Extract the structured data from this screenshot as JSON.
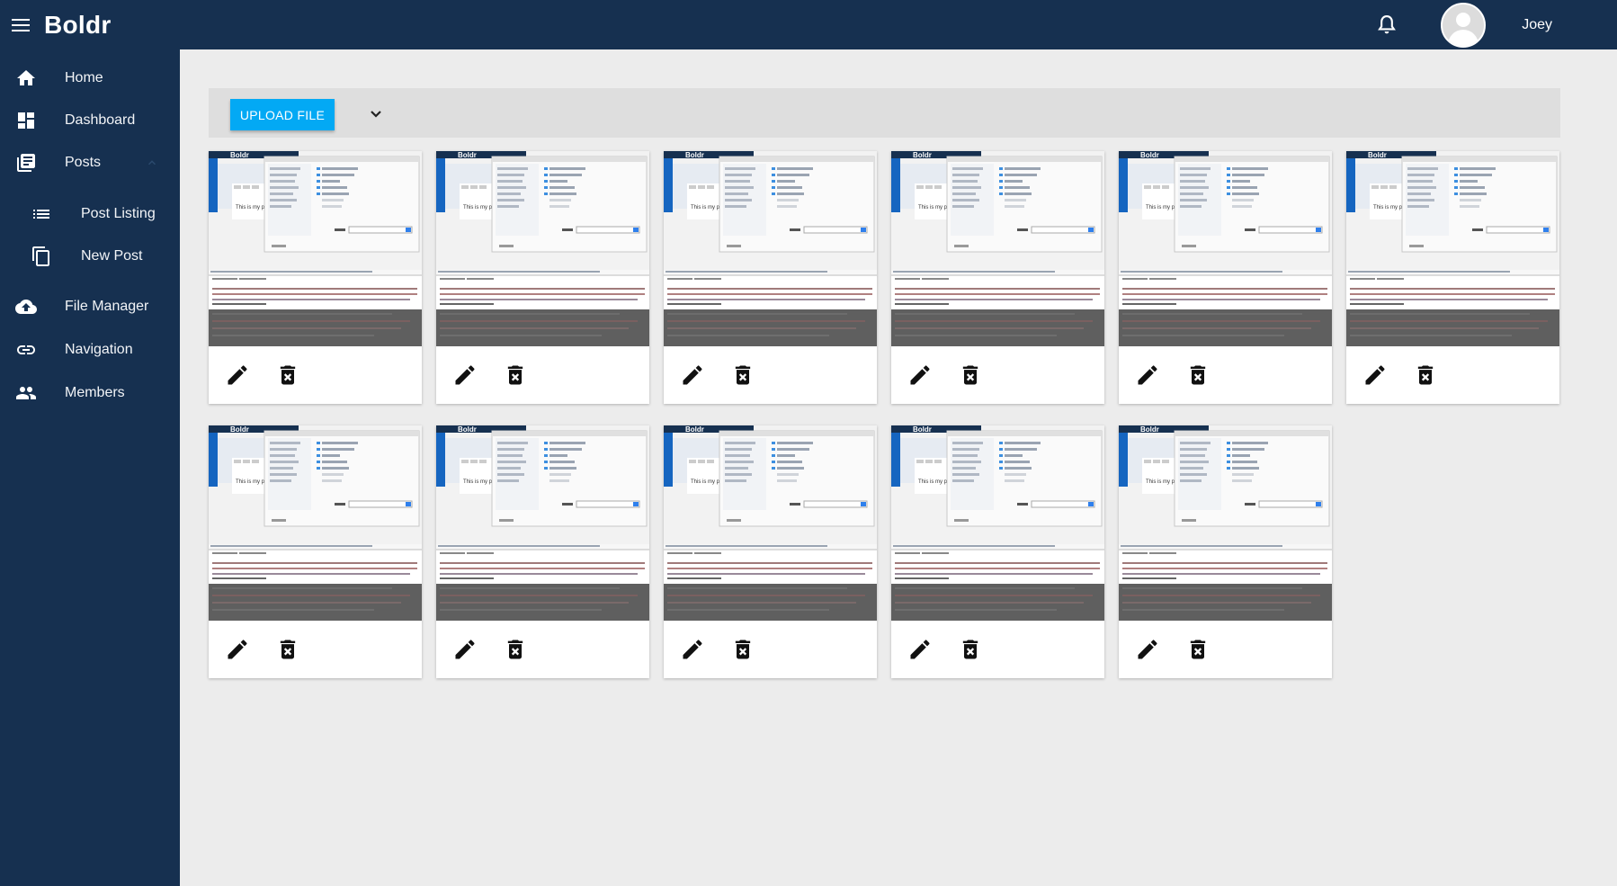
{
  "app": {
    "title": "Boldr"
  },
  "header": {
    "user_name": "Joey",
    "notifications_icon": "bell-icon"
  },
  "sidebar": {
    "items": [
      {
        "label": "Home",
        "icon": "home-icon"
      },
      {
        "label": "Dashboard",
        "icon": "dashboard-icon"
      },
      {
        "label": "Posts",
        "icon": "posts-icon"
      },
      {
        "label": "Post Listing",
        "icon": "list-icon"
      },
      {
        "label": "New Post",
        "icon": "copy-icon"
      },
      {
        "label": "File Manager",
        "icon": "cloud-upload-icon"
      },
      {
        "label": "Navigation",
        "icon": "link-icon"
      },
      {
        "label": "Members",
        "icon": "people-icon"
      }
    ]
  },
  "toolbar": {
    "upload_label": "UPLOAD FILE"
  },
  "thumbnail": {
    "brand": "Boldr",
    "caption": "This is my post"
  },
  "file_count": 11,
  "colors": {
    "appbar": "#163050",
    "accent": "#03a9f4",
    "background": "#ececec"
  }
}
